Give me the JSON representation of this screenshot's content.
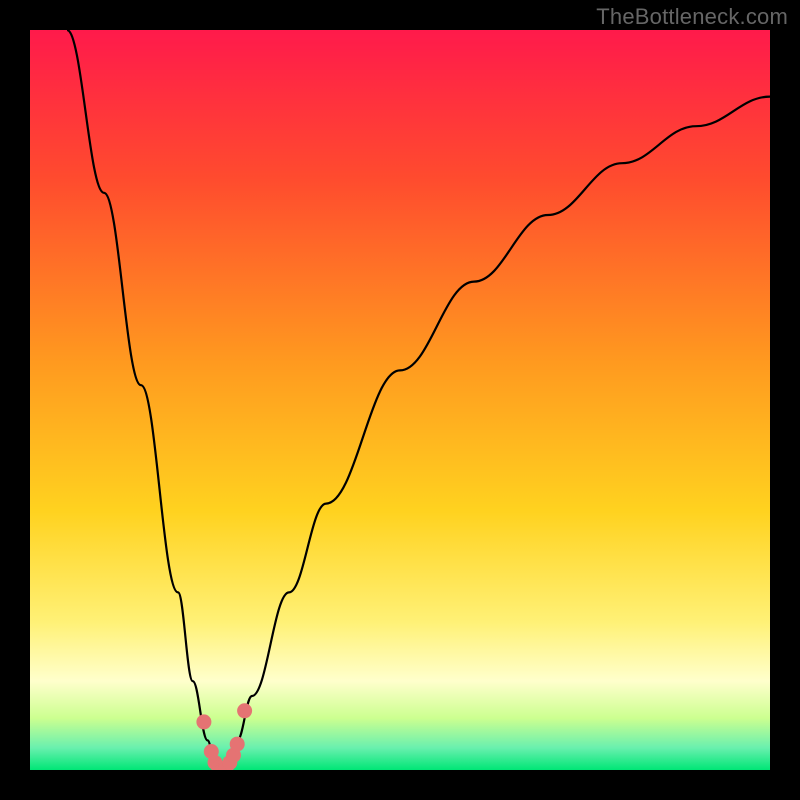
{
  "watermark": "TheBottleneck.com",
  "colors": {
    "top": "#ff1744",
    "upper_mid": "#ff5722",
    "mid": "#ffc107",
    "lower_mid": "#ffeb3b",
    "pale": "#ffffcc",
    "green": "#00e676",
    "curve": "#000000",
    "markers": "#e57373",
    "frame": "#000000"
  },
  "chart_data": {
    "type": "line",
    "title": "",
    "xlabel": "",
    "ylabel": "",
    "xlim": [
      0,
      100
    ],
    "ylim": [
      0,
      100
    ],
    "series": [
      {
        "name": "bottleneck-curve",
        "x": [
          5,
          10,
          15,
          20,
          22,
          24,
          25,
          26,
          27,
          28,
          30,
          35,
          40,
          50,
          60,
          70,
          80,
          90,
          100
        ],
        "y": [
          100,
          78,
          52,
          24,
          12,
          4,
          1,
          0,
          1,
          4,
          10,
          24,
          36,
          54,
          66,
          75,
          82,
          87,
          91
        ]
      }
    ],
    "markers": {
      "name": "highlight-points",
      "x": [
        23.5,
        24.5,
        25.0,
        25.5,
        26.0,
        26.5,
        27.0,
        27.5,
        28.0,
        29.0
      ],
      "y": [
        6.5,
        2.5,
        1.0,
        0.3,
        0.0,
        0.3,
        1.0,
        2.0,
        3.5,
        8.0
      ]
    },
    "gradient_stops": [
      {
        "offset": 0.0,
        "color": "#ff1a4b"
      },
      {
        "offset": 0.2,
        "color": "#ff4b2e"
      },
      {
        "offset": 0.45,
        "color": "#ff9a1f"
      },
      {
        "offset": 0.65,
        "color": "#ffd21f"
      },
      {
        "offset": 0.8,
        "color": "#fff176"
      },
      {
        "offset": 0.88,
        "color": "#ffffcc"
      },
      {
        "offset": 0.93,
        "color": "#ccff90"
      },
      {
        "offset": 0.97,
        "color": "#69f0ae"
      },
      {
        "offset": 1.0,
        "color": "#00e676"
      }
    ]
  }
}
